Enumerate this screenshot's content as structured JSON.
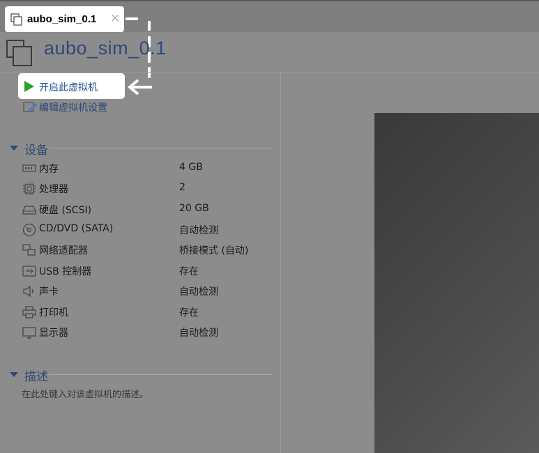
{
  "tab": {
    "title": "aubo_sim_0.1",
    "close_glyph": "✕",
    "icon": "vm-copy-icon"
  },
  "header": {
    "title": "aubo_sim_0.1",
    "icon": "vm-copy-icon"
  },
  "actions": {
    "power_on": {
      "label": "开启此虚拟机",
      "icon": "play-icon",
      "color": "#2aa12a"
    },
    "edit_settings": {
      "label": "编辑虚拟机设置",
      "icon": "edit-settings-icon"
    }
  },
  "devices": {
    "title": "设备",
    "items": [
      {
        "name": "内存",
        "value": "4 GB",
        "icon": "memory-icon"
      },
      {
        "name": "处理器",
        "value": "2",
        "icon": "processor-icon"
      },
      {
        "name": "硬盘 (SCSI)",
        "value": "20 GB",
        "icon": "hard-disk-icon"
      },
      {
        "name": "CD/DVD (SATA)",
        "value": "自动检测",
        "icon": "cd-dvd-icon"
      },
      {
        "name": "网络适配器",
        "value": "桥接模式 (自动)",
        "icon": "network-adapter-icon"
      },
      {
        "name": "USB 控制器",
        "value": "存在",
        "icon": "usb-icon"
      },
      {
        "name": "声卡",
        "value": "自动检测",
        "icon": "sound-card-icon"
      },
      {
        "name": "打印机",
        "value": "存在",
        "icon": "printer-icon"
      },
      {
        "name": "显示器",
        "value": "自动检测",
        "icon": "display-icon"
      }
    ]
  },
  "description": {
    "title": "描述",
    "placeholder": "在此处键入对该虚拟机的描述。"
  },
  "colors": {
    "accent": "#2f4a78",
    "link": "#1f4f95",
    "overlay": "#8c8c8c",
    "preview": "#404040"
  }
}
